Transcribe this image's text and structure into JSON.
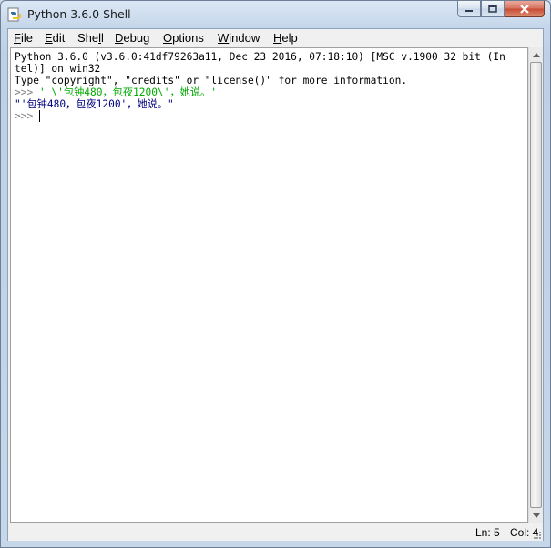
{
  "window": {
    "title": "Python 3.6.0 Shell",
    "icon": "python-idle-icon",
    "caption_buttons": [
      "minimize-icon",
      "maximize-icon",
      "close-icon"
    ]
  },
  "menubar": {
    "items": [
      {
        "label": "File",
        "mnemonic": "F",
        "rest": "ile"
      },
      {
        "label": "Edit",
        "mnemonic": "E",
        "rest": "dit"
      },
      {
        "label": "Shell",
        "before": "She",
        "mnemonic": "l",
        "rest": "l"
      },
      {
        "label": "Debug",
        "mnemonic": "D",
        "rest": "ebug"
      },
      {
        "label": "Options",
        "mnemonic": "O",
        "rest": "ptions"
      },
      {
        "label": "Window",
        "mnemonic": "W",
        "rest": "indow"
      },
      {
        "label": "Help",
        "mnemonic": "H",
        "rest": "elp"
      }
    ]
  },
  "shell": {
    "banner_line1": "Python 3.6.0 (v3.6.0:41df79263a11, Dec 23 2016, 07:18:10) [MSC v.1900 32 bit (In",
    "banner_line2": "tel)] on win32",
    "banner_line3": "Type \"copyright\", \"credits\" or \"license()\" for more information.",
    "prompt": ">>> ",
    "input_1": "' \\'包钟480，包夜1200\\'，她说。'",
    "output_1": "\"'包钟480，包夜1200'，她说。\"",
    "prompt_2": ">>> "
  },
  "statusbar": {
    "line": "Ln: 5",
    "col": "Col: 4"
  },
  "colors": {
    "prompt": "#7f7f7f",
    "string": "#00aa00",
    "output": "#000080",
    "stdout": "#000000"
  }
}
